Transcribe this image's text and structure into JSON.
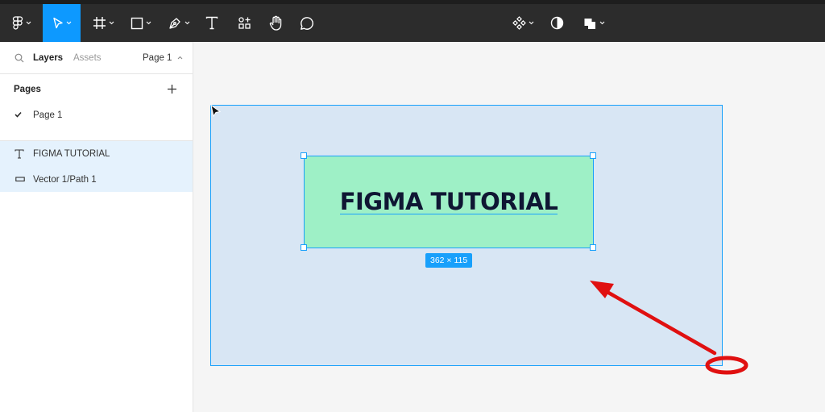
{
  "toolbar": {
    "tools": [
      "main-menu",
      "move",
      "frame",
      "shape",
      "pen",
      "text",
      "resources",
      "hand",
      "comment"
    ],
    "right_tools": [
      "components",
      "mask",
      "boolean-union"
    ]
  },
  "sidebar": {
    "tabs": {
      "layers": "Layers",
      "assets": "Assets",
      "page_selector": "Page 1"
    },
    "pages_title": "Pages",
    "pages": [
      {
        "label": "Page 1",
        "selected": true
      }
    ],
    "layers": [
      {
        "label": "FIGMA TUTORIAL",
        "icon": "text-icon"
      },
      {
        "label": "Vector 1/Path 1",
        "icon": "vector-icon"
      }
    ]
  },
  "canvas": {
    "text_content": "FIGMA TUTORIAL",
    "dimension_badge": "362 × 115"
  },
  "colors": {
    "toolbar_bg": "#2c2c2c",
    "active_tool": "#0d99ff",
    "selection_blue": "#18a0fb",
    "frame_fill": "#d8e6f4",
    "rect_fill": "#9ef0c6",
    "annotation_red": "#e01010"
  }
}
